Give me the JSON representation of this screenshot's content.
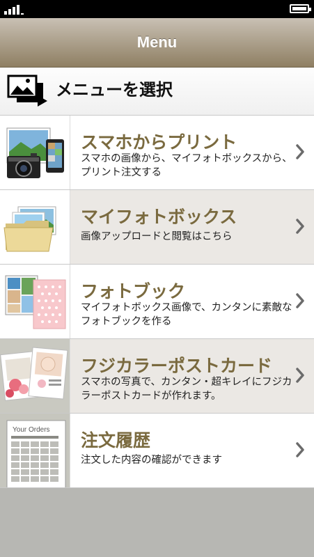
{
  "nav": {
    "title": "Menu"
  },
  "section": {
    "title": "メニューを選択"
  },
  "menu_items": [
    {
      "title": "スマホからプリント",
      "desc": "スマホの画像から、マイフォトボックスから、プリント注文する"
    },
    {
      "title": "マイフォトボックス",
      "desc": "画像アップロードと閲覧はこちら"
    },
    {
      "title": "フォトブック",
      "desc": "マイフォトボックス画像で、カンタンに素敵なフォトブックを作る"
    },
    {
      "title": "フジカラーポストカード",
      "desc": "スマホの写真で、カンタン・超キレイにフジカラーポストカードが作れます。"
    },
    {
      "title": "注文履歴",
      "desc": "注文した内容の確認ができます"
    }
  ],
  "thumb_text": {
    "orders": "Your Orders"
  },
  "colors": {
    "title": "#7a6a3f",
    "nav_bg": "#a69a83",
    "alt_row": "#ebe8e4"
  }
}
